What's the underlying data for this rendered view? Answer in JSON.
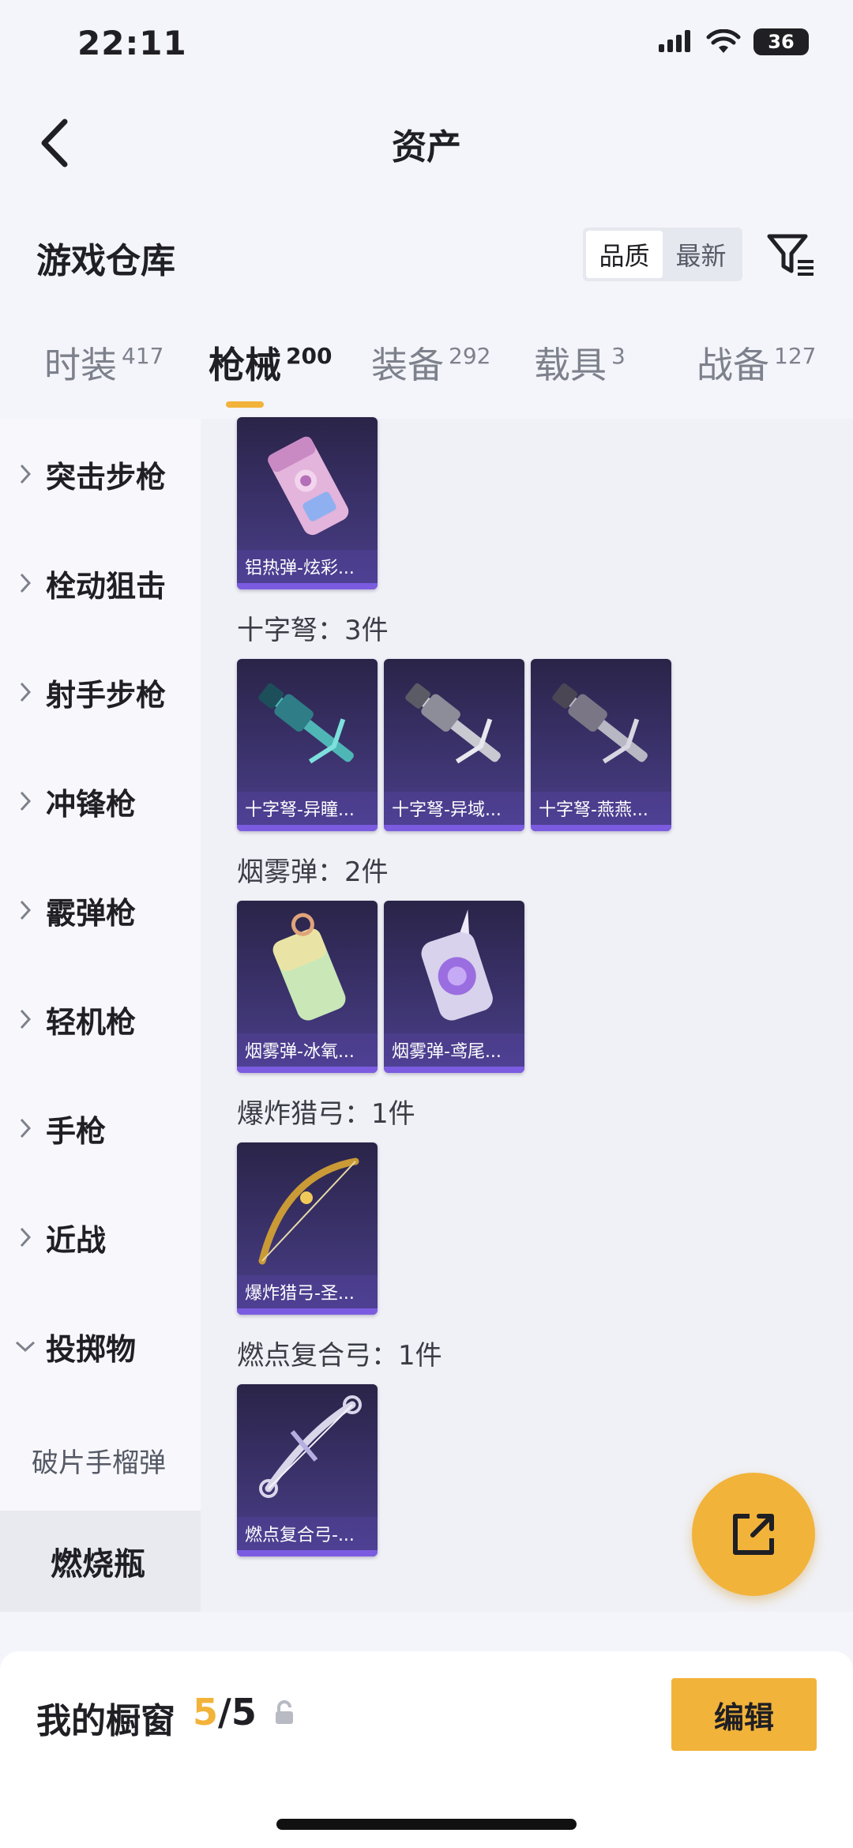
{
  "status": {
    "time": "22:11",
    "battery": "36"
  },
  "nav": {
    "title": "资产"
  },
  "warehouse": {
    "title": "游戏仓库",
    "sort_options": [
      "品质",
      "最新"
    ],
    "sort_active": "品质"
  },
  "tabs": [
    {
      "label": "时装",
      "count": "417"
    },
    {
      "label": "枪械",
      "count": "200",
      "active": true
    },
    {
      "label": "装备",
      "count": "292"
    },
    {
      "label": "载具",
      "count": "3"
    },
    {
      "label": "战备",
      "count": "127"
    }
  ],
  "sidebar": {
    "items": [
      "突击步枪",
      "栓动狙击",
      "射手步枪",
      "冲锋枪",
      "霰弹枪",
      "轻机枪",
      "手枪",
      "近战",
      "投掷物"
    ],
    "sub_item": "破片手榴弹",
    "selected": "燃烧瓶"
  },
  "content": {
    "top_card": "铝热弹-炫彩...",
    "groups": [
      {
        "title": "十字弩：3件",
        "cards": [
          "十字弩-异瞳...",
          "十字弩-异域...",
          "十字弩-燕燕..."
        ]
      },
      {
        "title": "烟雾弹：2件",
        "cards": [
          "烟雾弹-冰氧...",
          "烟雾弹-鸢尾..."
        ]
      },
      {
        "title": "爆炸猎弓：1件",
        "cards": [
          "爆炸猎弓-圣..."
        ]
      },
      {
        "title": "燃点复合弓：1件",
        "cards": [
          "燃点复合弓-..."
        ]
      }
    ]
  },
  "bottom": {
    "window_label": "我的橱窗",
    "window_current": "5",
    "window_total": "/5",
    "edit_label": "编辑"
  },
  "colors": {
    "accent": "#f2b33a",
    "card_bg": "#3d3470",
    "card_strip": "#7b5ce0"
  }
}
